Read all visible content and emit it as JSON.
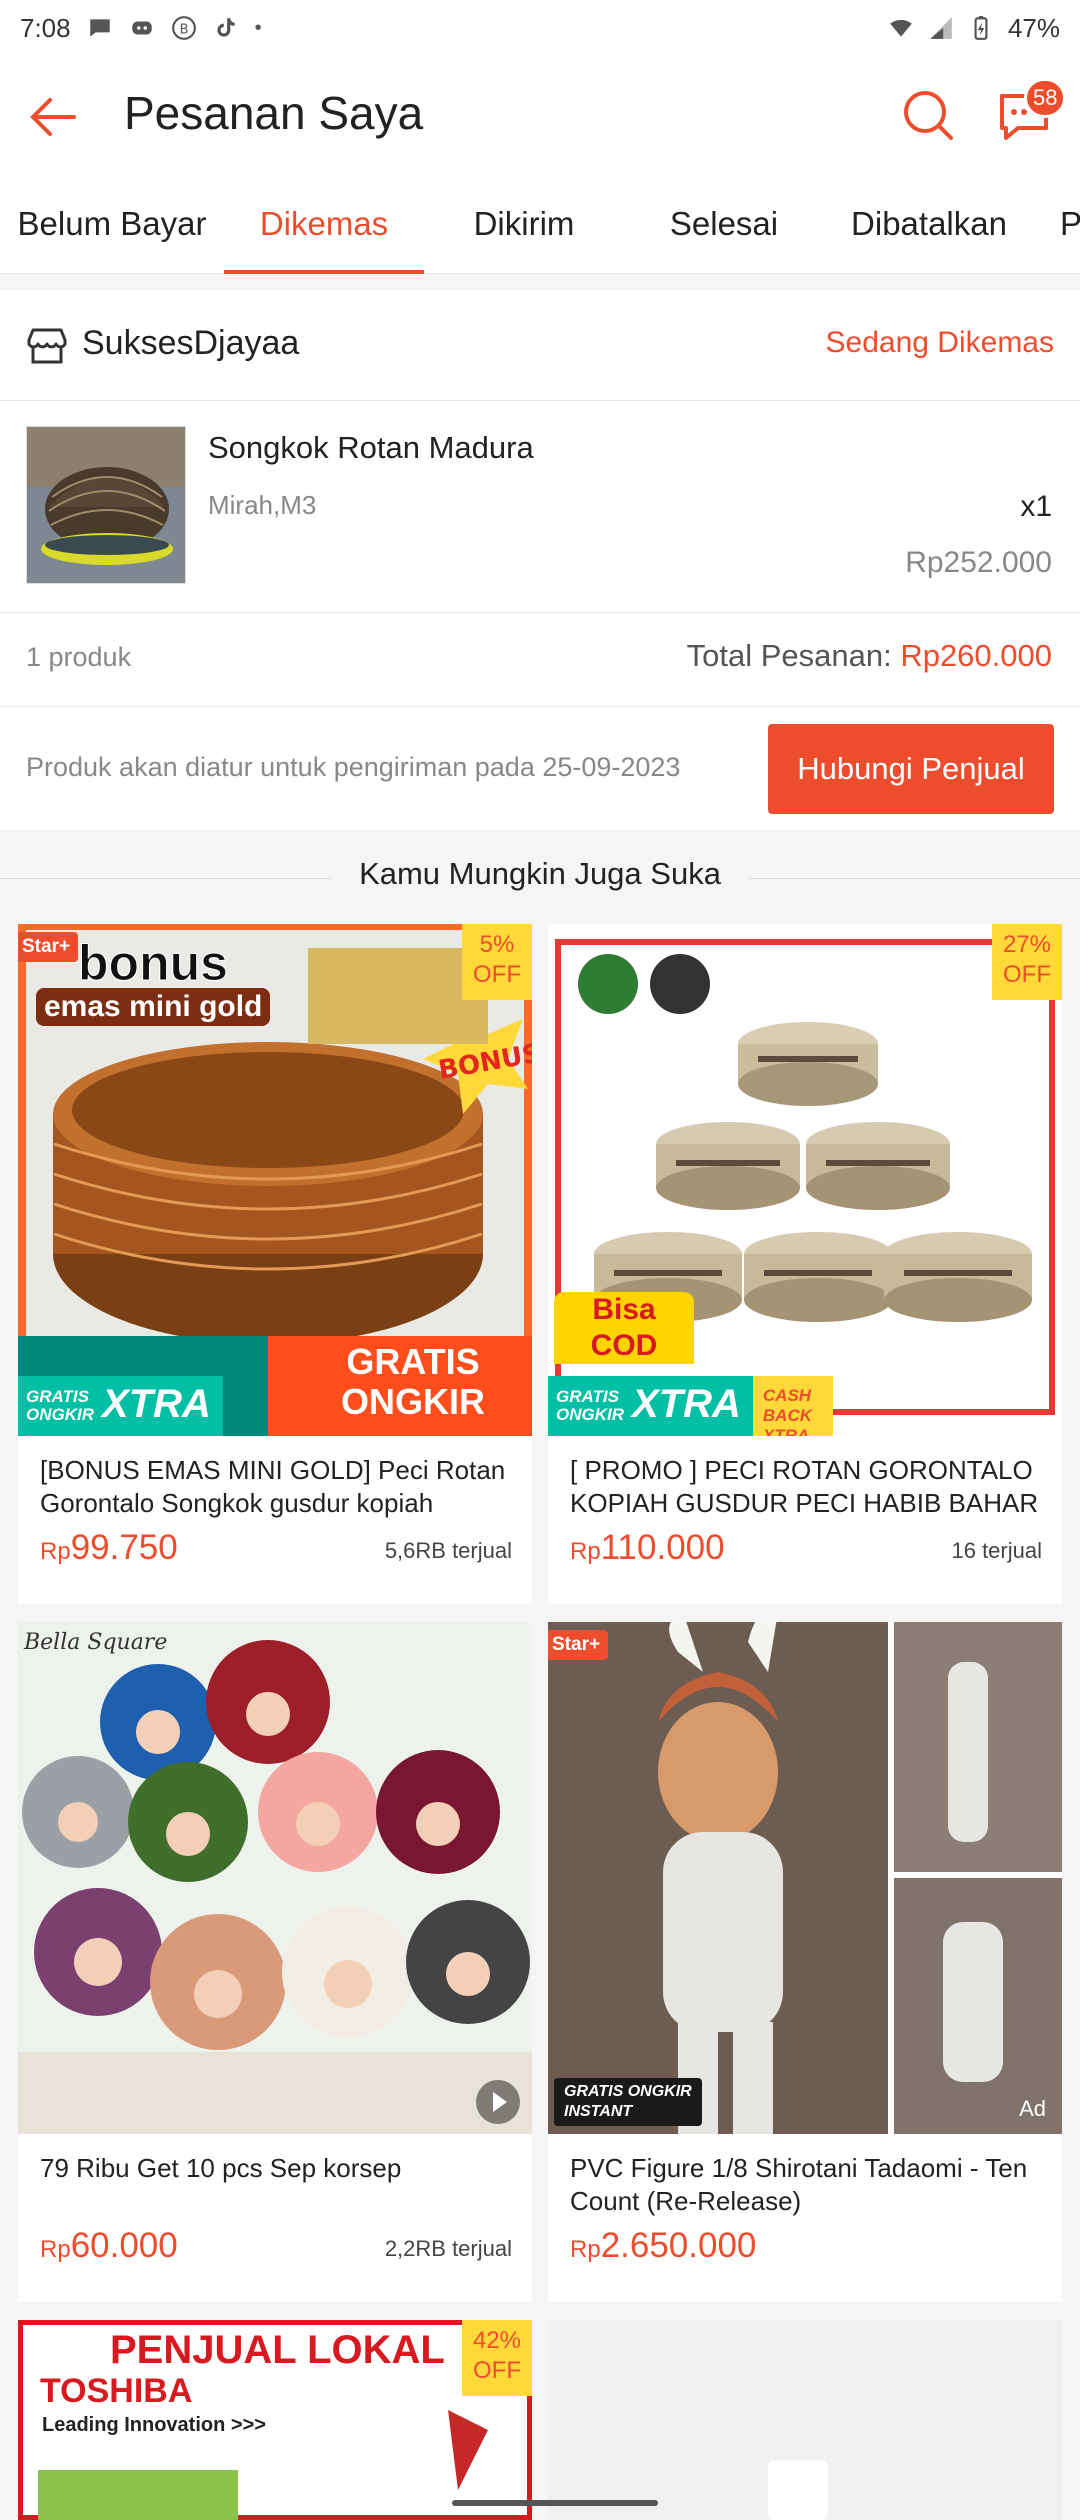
{
  "status_bar": {
    "time": "7:08",
    "battery": "47%"
  },
  "header": {
    "title": "Pesanan Saya",
    "chat_badge": "58"
  },
  "tabs": [
    {
      "label": "Belum Bayar",
      "active": false
    },
    {
      "label": "Dikemas",
      "active": true
    },
    {
      "label": "Dikirim",
      "active": false
    },
    {
      "label": "Selesai",
      "active": false
    },
    {
      "label": "Dibatalkan",
      "active": false
    },
    {
      "label": "P",
      "active": false
    }
  ],
  "order": {
    "shop_name": "SuksesDjayaa",
    "status": "Sedang Dikemas",
    "product_name": "Songkok Rotan Madura",
    "variation": "Mirah,M3",
    "quantity": "x1",
    "price": "Rp252.000",
    "product_count": "1 produk",
    "total_label": "Total Pesanan: ",
    "total_value": "Rp260.000",
    "shipping_note": "Produk akan diatur untuk pengiriman pada 25-09-2023",
    "contact_button": "Hubungi Penjual"
  },
  "recommendations": {
    "heading": "Kamu Mungkin Juga Suka",
    "items": [
      {
        "name": "[BONUS EMAS MINI GOLD] Peci Rotan Gorontalo Songkok gusdur kopiah gusdur …",
        "currency": "Rp",
        "price": "99.750",
        "sold": "5,6RB terjual",
        "discount": "5%\nOFF",
        "star_badge": "Star+",
        "banner_top": "bonus",
        "banner_sub": "emas mini gold",
        "banner_bottom": "GRATIS\nONGKIR",
        "ship_a": "GRATIS\nONGKIR",
        "ship_b": "XTRA"
      },
      {
        "name": "[ PROMO ] PECI ROTAN GORONTALO KOPIAH GUSDUR PECI HABIB BAHAR PE…",
        "currency": "Rp",
        "price": "110.000",
        "sold": "16 terjual",
        "discount": "27%\nOFF",
        "cod": "Bisa\nCOD",
        "ship_a": "GRATIS\nONGKIR",
        "ship_b": "XTRA",
        "ship_c": "CASH BACK XTRA"
      },
      {
        "name": "79 Ribu Get 10 pcs Sep korsep",
        "currency": "Rp",
        "price": "60.000",
        "sold": "2,2RB terjual",
        "brand_text": "Bella Square"
      },
      {
        "name": "PVC Figure 1/8 Shirotani Tadaomi - Ten Count (Re-Release)",
        "currency": "Rp",
        "price": "2.650.000",
        "star_badge": "Star+",
        "ship_instant": "GRATIS ONGKIR\nINSTANT",
        "ad_label": "Ad"
      },
      {
        "discount": "42%\nOFF",
        "banner_top": "PENJUAL LOKAL",
        "brand": "TOSHIBA",
        "tagline": "Leading Innovation >>>"
      },
      {}
    ]
  },
  "colors": {
    "accent": "#ee4d2d",
    "off_badge": "#ffd839",
    "free_ship": "#00bfa5"
  }
}
